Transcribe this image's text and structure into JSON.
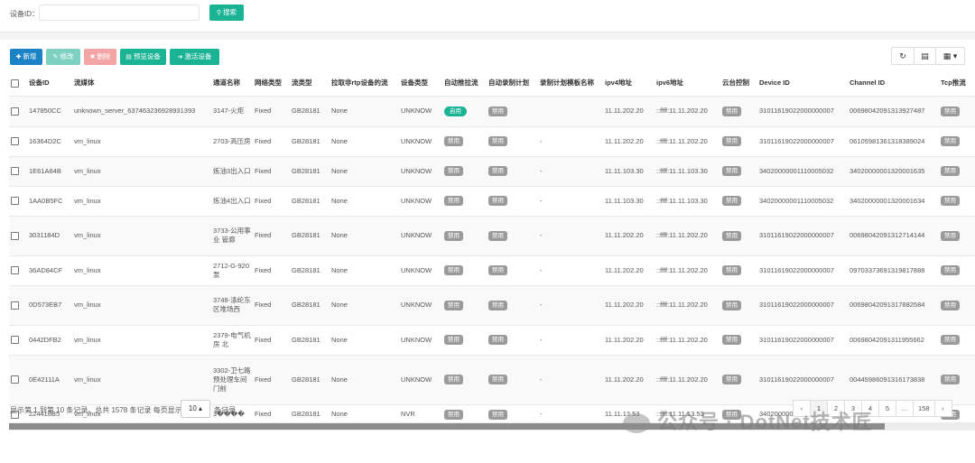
{
  "search": {
    "label": "设备ID：",
    "value": "",
    "button_label": "搜索"
  },
  "toolbar": {
    "add": "新增",
    "edit": "修改",
    "delete": "删除",
    "preview": "预览设备",
    "activate": "激活设备"
  },
  "icons": {
    "search": "search-icon",
    "add": "plus-icon",
    "edit": "edit-icon",
    "delete": "remove-icon",
    "preview": "file-icon",
    "activate": "sign-in-icon",
    "refresh": "refresh-icon",
    "toggle": "list-icon",
    "columns": "grid-icon"
  },
  "colors": {
    "primary": "#1ab394",
    "blue": "#1c84c6",
    "danger_light": "#f3a4a4",
    "badge_grey": "#9a9a9a"
  },
  "table": {
    "columns": [
      "设备ID",
      "流媒体",
      "通道名称",
      "网络类型",
      "流类型",
      "拉取非rtp设备的流",
      "设备类型",
      "自动推拉流",
      "自动录制计划",
      "录制计划模板名称",
      "ipv4地址",
      "ipv6地址",
      "云台控制",
      "Device ID",
      "Channel ID",
      "Tcp推流"
    ],
    "rows": [
      {
        "id": "147850CC",
        "media": "unknown_server_637463236928931393",
        "channel": "3147-火炬",
        "net": "Fixed",
        "stream": "GB28181",
        "pull": "None",
        "dtype": "UNKNOW",
        "autopush": "启用",
        "autopush_on": true,
        "record": "禁用",
        "template": "",
        "ipv4": "11.11.202.20",
        "ipv6": "::ffff:11.11.202.20",
        "ptz": "禁用",
        "device_id": "31011619022000000007",
        "channel_id": "00698042091313927487",
        "tcp": "禁用"
      },
      {
        "id": "16364D2C",
        "media": "vm_linux",
        "channel": "2703-高压房",
        "net": "Fixed",
        "stream": "GB28181",
        "pull": "None",
        "dtype": "UNKNOW",
        "autopush": "禁用",
        "autopush_on": false,
        "record": "禁用",
        "template": "-",
        "ipv4": "11.11.202.20",
        "ipv6": "::ffff:11.11.202.20",
        "ptz": "禁用",
        "device_id": "31011619022000000007",
        "channel_id": "06105981361318389024",
        "tcp": "禁用"
      },
      {
        "id": "1E61A84B",
        "media": "vm_linux",
        "channel": "炼油3出入口",
        "net": "Fixed",
        "stream": "GB28181",
        "pull": "None",
        "dtype": "UNKNOW",
        "autopush": "禁用",
        "autopush_on": false,
        "record": "禁用",
        "template": "-",
        "ipv4": "11.11.103.30",
        "ipv6": "::ffff:11.11.103.30",
        "ptz": "禁用",
        "device_id": "34020000001110005032",
        "channel_id": "34020000001320001635",
        "tcp": "禁用"
      },
      {
        "id": "1AA0B5FC",
        "media": "vm_linux",
        "channel": "炼油4出入口",
        "net": "Fixed",
        "stream": "GB28181",
        "pull": "None",
        "dtype": "UNKNOW",
        "autopush": "禁用",
        "autopush_on": false,
        "record": "禁用",
        "template": "-",
        "ipv4": "11.11.103.30",
        "ipv6": "::ffff:11.11.103.30",
        "ptz": "禁用",
        "device_id": "34020000001110005032",
        "channel_id": "34020000001320001634",
        "tcp": "禁用"
      },
      {
        "id": "3031184D",
        "media": "vm_linux",
        "channel": "3733-公用事业 管廊",
        "net": "Fixed",
        "stream": "GB28181",
        "pull": "None",
        "dtype": "UNKNOW",
        "autopush": "禁用",
        "autopush_on": false,
        "record": "禁用",
        "template": "-",
        "ipv4": "11.11.202.20",
        "ipv6": "::ffff:11.11.202.20",
        "ptz": "禁用",
        "device_id": "31011619022000000007",
        "channel_id": "00698042091312714144",
        "tcp": "禁用"
      },
      {
        "id": "36AD84CF",
        "media": "vm_linux",
        "channel": "2712-G-920泵",
        "net": "Fixed",
        "stream": "GB28181",
        "pull": "None",
        "dtype": "UNKNOW",
        "autopush": "禁用",
        "autopush_on": false,
        "record": "禁用",
        "template": "-",
        "ipv4": "11.11.202.20",
        "ipv6": "::ffff:11.11.202.20",
        "ptz": "禁用",
        "device_id": "31011619022000000007",
        "channel_id": "09703373691319817888",
        "tcp": "禁用"
      },
      {
        "id": "0D573EB7",
        "media": "vm_linux",
        "channel": "3748-涤纶东区堆场西",
        "net": "Fixed",
        "stream": "GB28181",
        "pull": "None",
        "dtype": "UNKNOW",
        "autopush": "禁用",
        "autopush_on": false,
        "record": "禁用",
        "template": "-",
        "ipv4": "11.11.202.20",
        "ipv6": "::ffff:11.11.202.20",
        "ptz": "禁用",
        "device_id": "31011619022000000007",
        "channel_id": "00698042091317882584",
        "tcp": "禁用"
      },
      {
        "id": "0442DFB2",
        "media": "vm_linux",
        "channel": "2379-电气机房 北",
        "net": "Fixed",
        "stream": "GB28181",
        "pull": "None",
        "dtype": "UNKNOW",
        "autopush": "禁用",
        "autopush_on": false,
        "record": "禁用",
        "template": "-",
        "ipv4": "11.11.202.20",
        "ipv6": "::ffff:11.11.202.20",
        "ptz": "禁用",
        "device_id": "31011619022000000007",
        "channel_id": "00698042091311955662",
        "tcp": "禁用"
      },
      {
        "id": "0E42111A",
        "media": "vm_linux",
        "channel": "3302-卫七路预处理车间门前",
        "net": "Fixed",
        "stream": "GB28181",
        "pull": "None",
        "dtype": "UNKNOW",
        "autopush": "禁用",
        "autopush_on": false,
        "record": "禁用",
        "template": "-",
        "ipv4": "11.11.202.20",
        "ipv6": "::ffff:11.11.202.20",
        "ptz": "禁用",
        "device_id": "31011619022000000007",
        "channel_id": "00445986091316173838",
        "tcp": "禁用"
      },
      {
        "id": "224418B5",
        "media": "vm_linux",
        "channel": "3����",
        "net": "Fixed",
        "stream": "GB28181",
        "pull": "None",
        "dtype": "NVR",
        "autopush": "禁用",
        "autopush_on": false,
        "record": "禁用",
        "template": "-",
        "ipv4": "11.11.13.53",
        "ipv6": "::ffff:11.11.13.53",
        "ptz": "禁用",
        "device_id": "34020000001320000244",
        "channel_id": "34020000001320000244",
        "tcp": "禁用"
      }
    ]
  },
  "footer": {
    "info": "显示第 1 到第 10 条记录，总共 1578 条记录 每页显示",
    "page_size": "10 ▴",
    "suffix": "条记录"
  },
  "pagination": [
    "‹",
    "1",
    "2",
    "3",
    "4",
    "5",
    "...",
    "158",
    "›"
  ],
  "watermark": "公众号 · DotNet技术匠"
}
